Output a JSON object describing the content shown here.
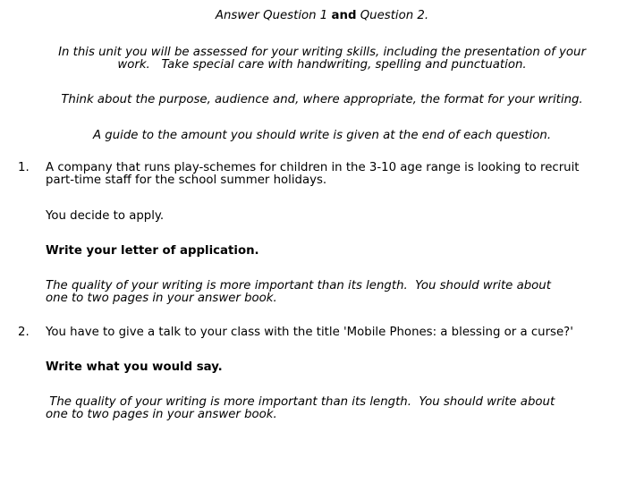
{
  "header": {
    "instruction_prefix": "Answer Question 1 ",
    "instruction_and": "and",
    "instruction_suffix": " Question 2."
  },
  "intro": {
    "assessment_line1": "In this unit you will be assessed for your writing skills, including the presentation of your",
    "assessment_line2": "work.   Take special care with handwriting, spelling and punctuation.",
    "purpose": "Think about the purpose, audience and, where appropriate, the format for your writing.",
    "guide": "A guide to the amount you should write is given at the end of each question."
  },
  "questions": [
    {
      "number": "1.",
      "prompt_line1": "A company that runs play-schemes for children in the 3-10 age range is looking to recruit",
      "prompt_line2": "part-time staff for the school summer holidays.",
      "context": "You decide to apply.",
      "task": "Write your letter of application.",
      "guidance_line1": "The quality of your writing is more important than its length.  You should write about",
      "guidance_line2": "one to two pages in your answer book."
    },
    {
      "number": "2.",
      "prompt_line1": "You have to give a talk to your class with the title 'Mobile Phones: a blessing or a curse?'",
      "task": "Write what you would say.",
      "guidance_line1": " The quality of your writing is more important than its length.  You should write about",
      "guidance_line2": "one to two pages in your answer book."
    }
  ]
}
